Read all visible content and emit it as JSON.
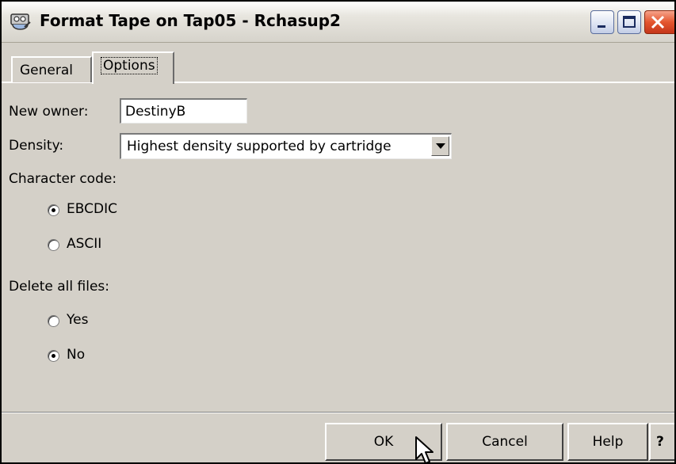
{
  "window": {
    "title": "Format Tape on Tap05 - Rchasup2",
    "icon": "tape-drive-icon"
  },
  "tabs": [
    {
      "label": "General",
      "active": false
    },
    {
      "label": "Options",
      "active": true
    }
  ],
  "form": {
    "owner_label": "New owner:",
    "owner_value": "DestinyB",
    "density_label": "Density:",
    "density_value": "Highest density supported by cartridge",
    "charcode_label": "Character code:",
    "charcode_options": [
      {
        "label": "EBCDIC",
        "checked": true
      },
      {
        "label": "ASCII",
        "checked": false
      }
    ],
    "delete_label": "Delete all files:",
    "delete_options": [
      {
        "label": "Yes",
        "checked": false
      },
      {
        "label": "No",
        "checked": true
      }
    ]
  },
  "buttons": {
    "ok": "OK",
    "cancel": "Cancel",
    "help": "Help",
    "context_help": "?"
  },
  "colors": {
    "dialog_bg": "#d4d0c8",
    "close_button": "#e4562e",
    "titlebar": "#e8e6df"
  }
}
